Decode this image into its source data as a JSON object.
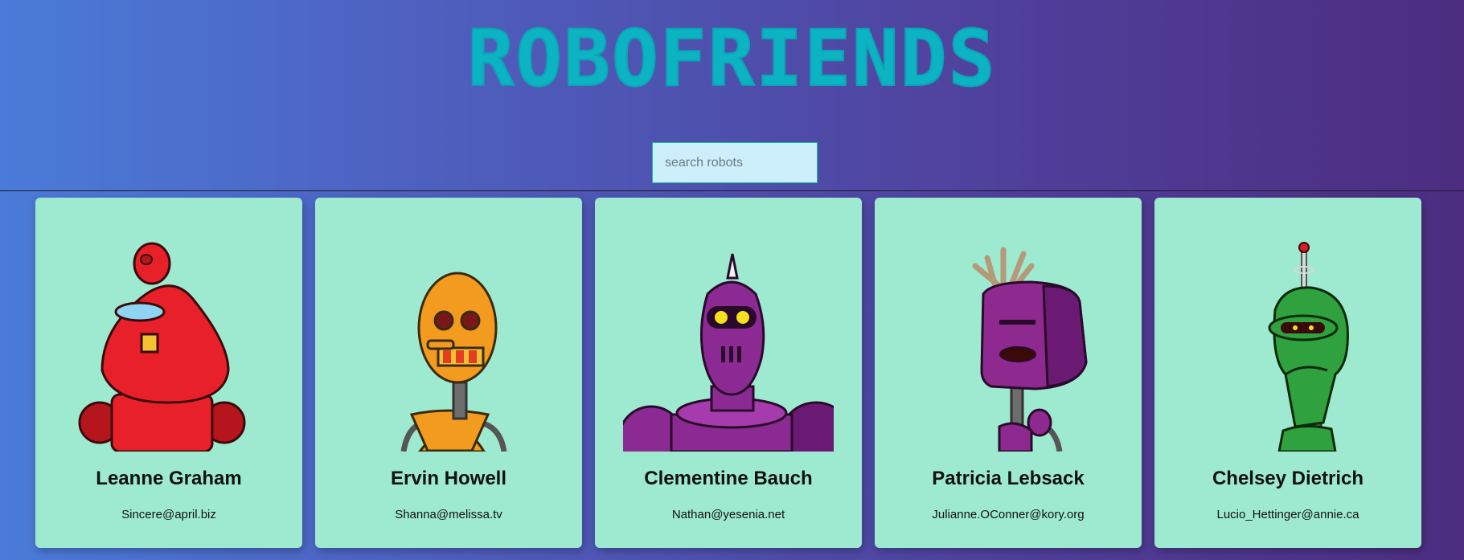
{
  "app": {
    "title": "ROBOFRIENDS"
  },
  "search": {
    "placeholder": "search robots",
    "value": ""
  },
  "robots": [
    {
      "name": "Leanne Graham",
      "email": "Sincere@april.biz",
      "color": "#e8202a"
    },
    {
      "name": "Ervin Howell",
      "email": "Shanna@melissa.tv",
      "color": "#f39b1f"
    },
    {
      "name": "Clementine Bauch",
      "email": "Nathan@yesenia.net",
      "color": "#8b2a93"
    },
    {
      "name": "Patricia Lebsack",
      "email": "Julianne.OConner@kory.org",
      "color": "#8e2a8f"
    },
    {
      "name": "Chelsey Dietrich",
      "email": "Lucio_Hettinger@annie.ca",
      "color": "#2fa13f"
    }
  ]
}
